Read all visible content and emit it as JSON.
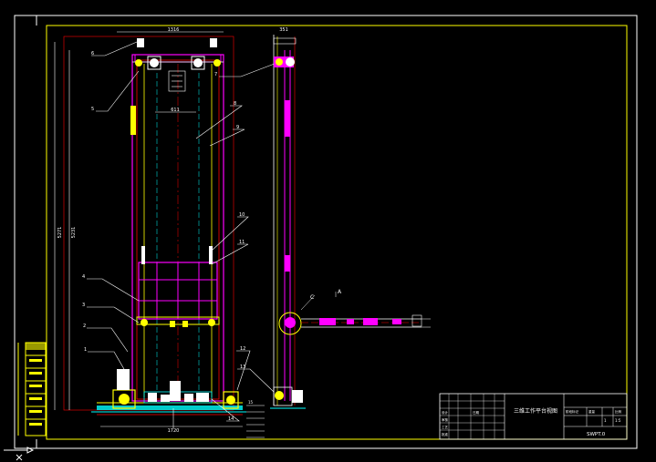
{
  "drawing": {
    "title_cn": "三维工作平台视图",
    "drawing_no": "SWPT.0",
    "scale": "1:5",
    "sheet": "1"
  },
  "dimensions": {
    "top_width": "1316",
    "inner_width": "611",
    "bottom_width": "1720",
    "height_outer": "5271",
    "height_inner": "5231",
    "side_width": "351"
  },
  "balloons": [
    "1",
    "2",
    "3",
    "4",
    "5",
    "6",
    "7",
    "8",
    "9",
    "10",
    "11",
    "12",
    "13",
    "14",
    "15"
  ],
  "view_mark": "A",
  "section_mark": "C",
  "title_block": {
    "row_labels": [
      "设计",
      "审核",
      "工艺",
      "批准",
      "日期"
    ],
    "mid_labels": [
      "阶段标记",
      "重量",
      "比例"
    ]
  },
  "colors": {
    "frame": "#ffffff",
    "magenta": "#ff00ff",
    "yellow": "#ffff00",
    "cyan": "#00ffff",
    "red": "#ff0000",
    "green": "#00ff00",
    "blue": "#0000ff"
  }
}
